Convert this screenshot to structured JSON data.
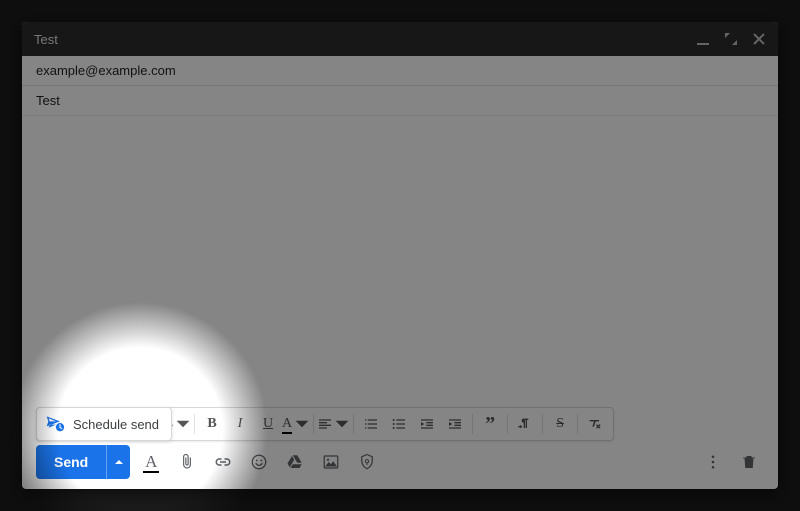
{
  "window": {
    "title": "Test"
  },
  "fields": {
    "to": "example@example.com",
    "subject": "Test"
  },
  "schedule_popup": {
    "label": "Schedule send"
  },
  "actions": {
    "send_label": "Send"
  }
}
